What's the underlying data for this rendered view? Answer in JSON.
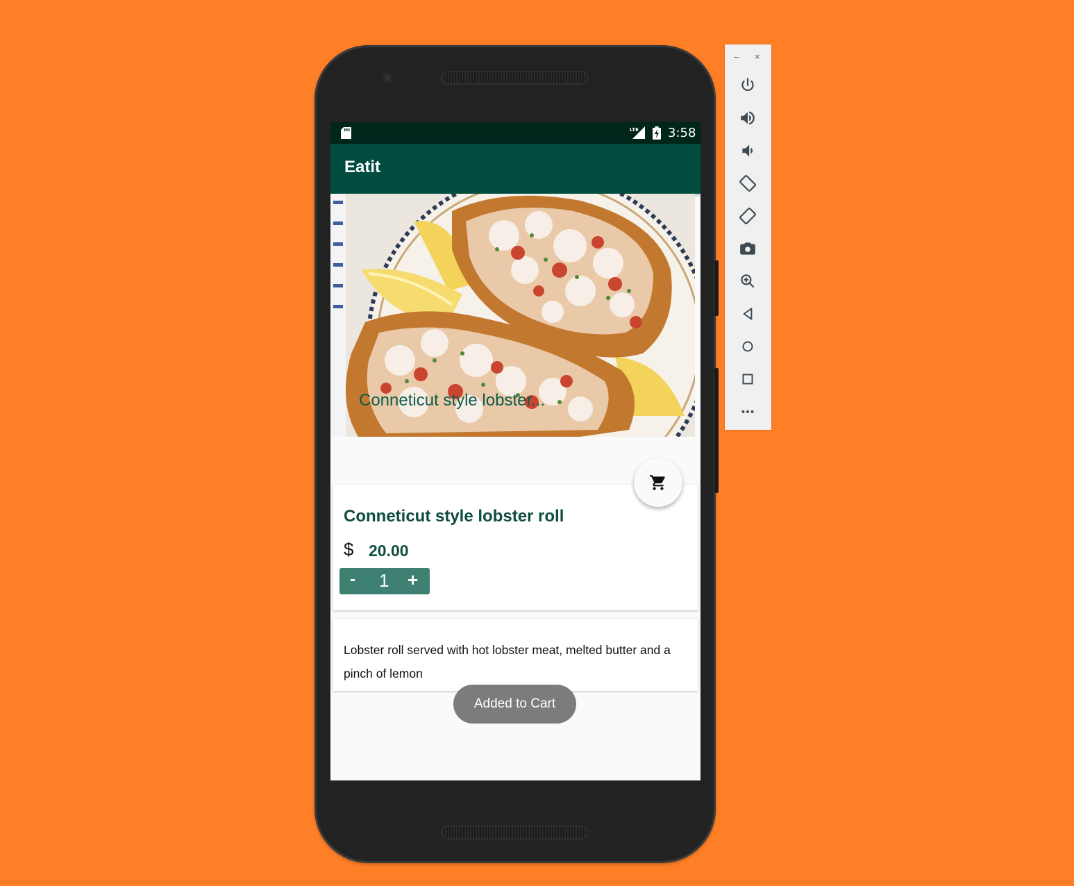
{
  "statusbar": {
    "time": "3:58",
    "network": "LTE"
  },
  "appbar": {
    "title": "Eatit"
  },
  "food": {
    "hero_title": "Conneticut style lobster...",
    "name": "Conneticut style lobster roll",
    "currency_symbol": "$",
    "price": "20.00",
    "quantity": "1",
    "minus_label": "-",
    "plus_label": "+",
    "description": "Lobster roll served with hot lobster meat, melted butter and a pinch of lemon"
  },
  "toast": {
    "message": "Added to Cart"
  },
  "icons": {
    "cart": "shopping-cart-icon",
    "sd": "sd-card-icon",
    "battery": "battery-charging-icon",
    "nav": [
      "back-icon",
      "home-icon",
      "recents-icon"
    ],
    "toolbar": [
      "power-icon",
      "volume-up-icon",
      "volume-down-icon",
      "rotate-left-icon",
      "rotate-right-icon",
      "camera-icon",
      "zoom-icon",
      "back-icon",
      "home-icon",
      "overview-icon",
      "more-icon"
    ]
  },
  "toolbar": {
    "minimize": "–",
    "close": "×",
    "more": "•••"
  },
  "colors": {
    "background": "#FF7F27",
    "primary": "#004D40",
    "primary_dark": "#00251A",
    "accent_text": "#0F4D3F",
    "stepper": "#3E8072"
  }
}
